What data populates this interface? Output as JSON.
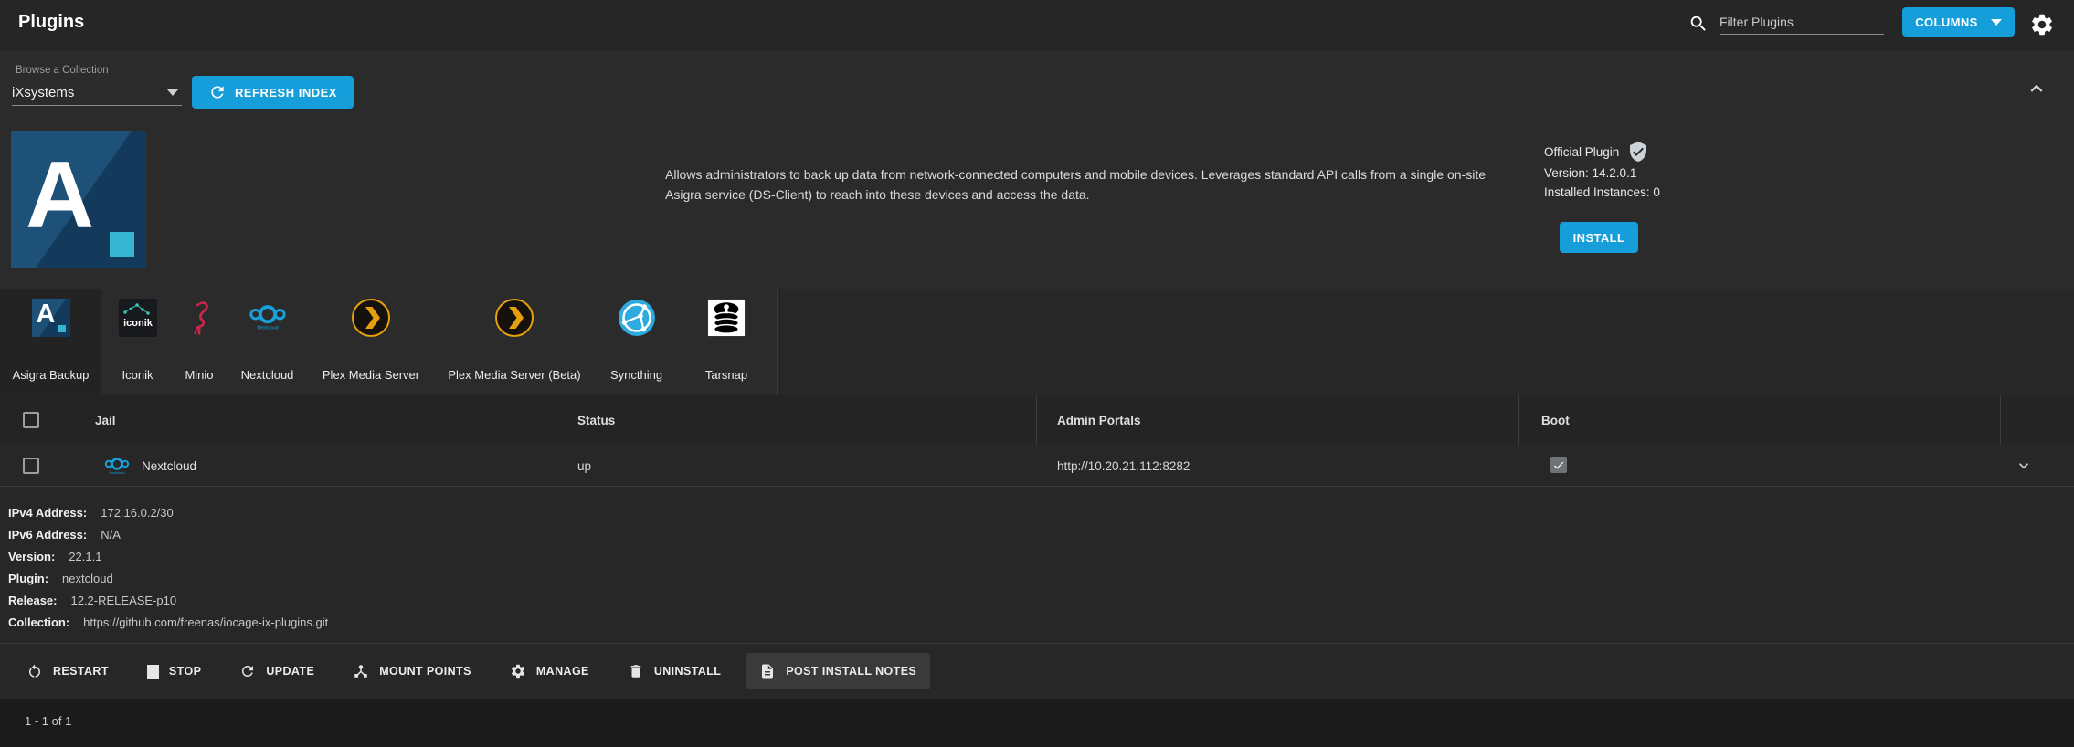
{
  "header": {
    "title": "Plugins",
    "filter_placeholder": "Filter Plugins",
    "columns_label": "COLUMNS"
  },
  "collection": {
    "label": "Browse a Collection",
    "selected": "iXsystems",
    "refresh_label": "REFRESH INDEX"
  },
  "plugin_info": {
    "description": "Allows administrators to back up data from network-connected computers and mobile devices. Leverages standard API calls from a single on-site Asigra service (DS-Client) to reach into these devices and access the data.",
    "official_label": "Official Plugin",
    "version": "Version: 14.2.0.1",
    "installed": "Installed Instances: 0",
    "install_label": "INSTALL"
  },
  "plugins": [
    {
      "name": "Asigra Backup",
      "selected": true
    },
    {
      "name": "Iconik",
      "selected": false
    },
    {
      "name": "Minio",
      "selected": false
    },
    {
      "name": "Nextcloud",
      "selected": false
    },
    {
      "name": "Plex Media Server",
      "selected": false
    },
    {
      "name": "Plex Media Server (Beta)",
      "selected": false
    },
    {
      "name": "Syncthing",
      "selected": false
    },
    {
      "name": "Tarsnap",
      "selected": false
    }
  ],
  "table": {
    "columns": [
      "Jail",
      "Status",
      "Admin Portals",
      "Boot"
    ],
    "rows": [
      {
        "jail": "Nextcloud",
        "status": "up",
        "admin_portal": "http://10.20.21.112:8282",
        "boot": true
      }
    ]
  },
  "details": [
    {
      "label": "IPv4 Address:",
      "value": "172.16.0.2/30"
    },
    {
      "label": "IPv6 Address:",
      "value": "N/A"
    },
    {
      "label": "Version:",
      "value": "22.1.1"
    },
    {
      "label": "Plugin:",
      "value": "nextcloud"
    },
    {
      "label": "Release:",
      "value": "12.2-RELEASE-p10"
    },
    {
      "label": "Collection:",
      "value": "https://github.com/freenas/iocage-ix-plugins.git"
    }
  ],
  "actions": [
    {
      "label": "RESTART",
      "icon": "restart-icon"
    },
    {
      "label": "STOP",
      "icon": "stop-icon"
    },
    {
      "label": "UPDATE",
      "icon": "update-icon"
    },
    {
      "label": "MOUNT POINTS",
      "icon": "mount-points-icon"
    },
    {
      "label": "MANAGE",
      "icon": "manage-icon"
    },
    {
      "label": "UNINSTALL",
      "icon": "uninstall-icon"
    },
    {
      "label": "POST INSTALL NOTES",
      "icon": "post-install-notes-icon"
    }
  ],
  "footer": {
    "paginator": "1 - 1 of 1"
  },
  "colors": {
    "accent_blue": "#159ed9",
    "panel_bg": "#2b2b2b",
    "footer_bg": "#1b1b1b",
    "nextcloud_blue": "#18a0da",
    "plex_orange": "#e5a00d",
    "syncthing_blue": "#2cabdf",
    "minio_red": "#c9274a",
    "iconik_teal": "#3cc4b7",
    "asigra_cyan": "#35b5cf"
  }
}
